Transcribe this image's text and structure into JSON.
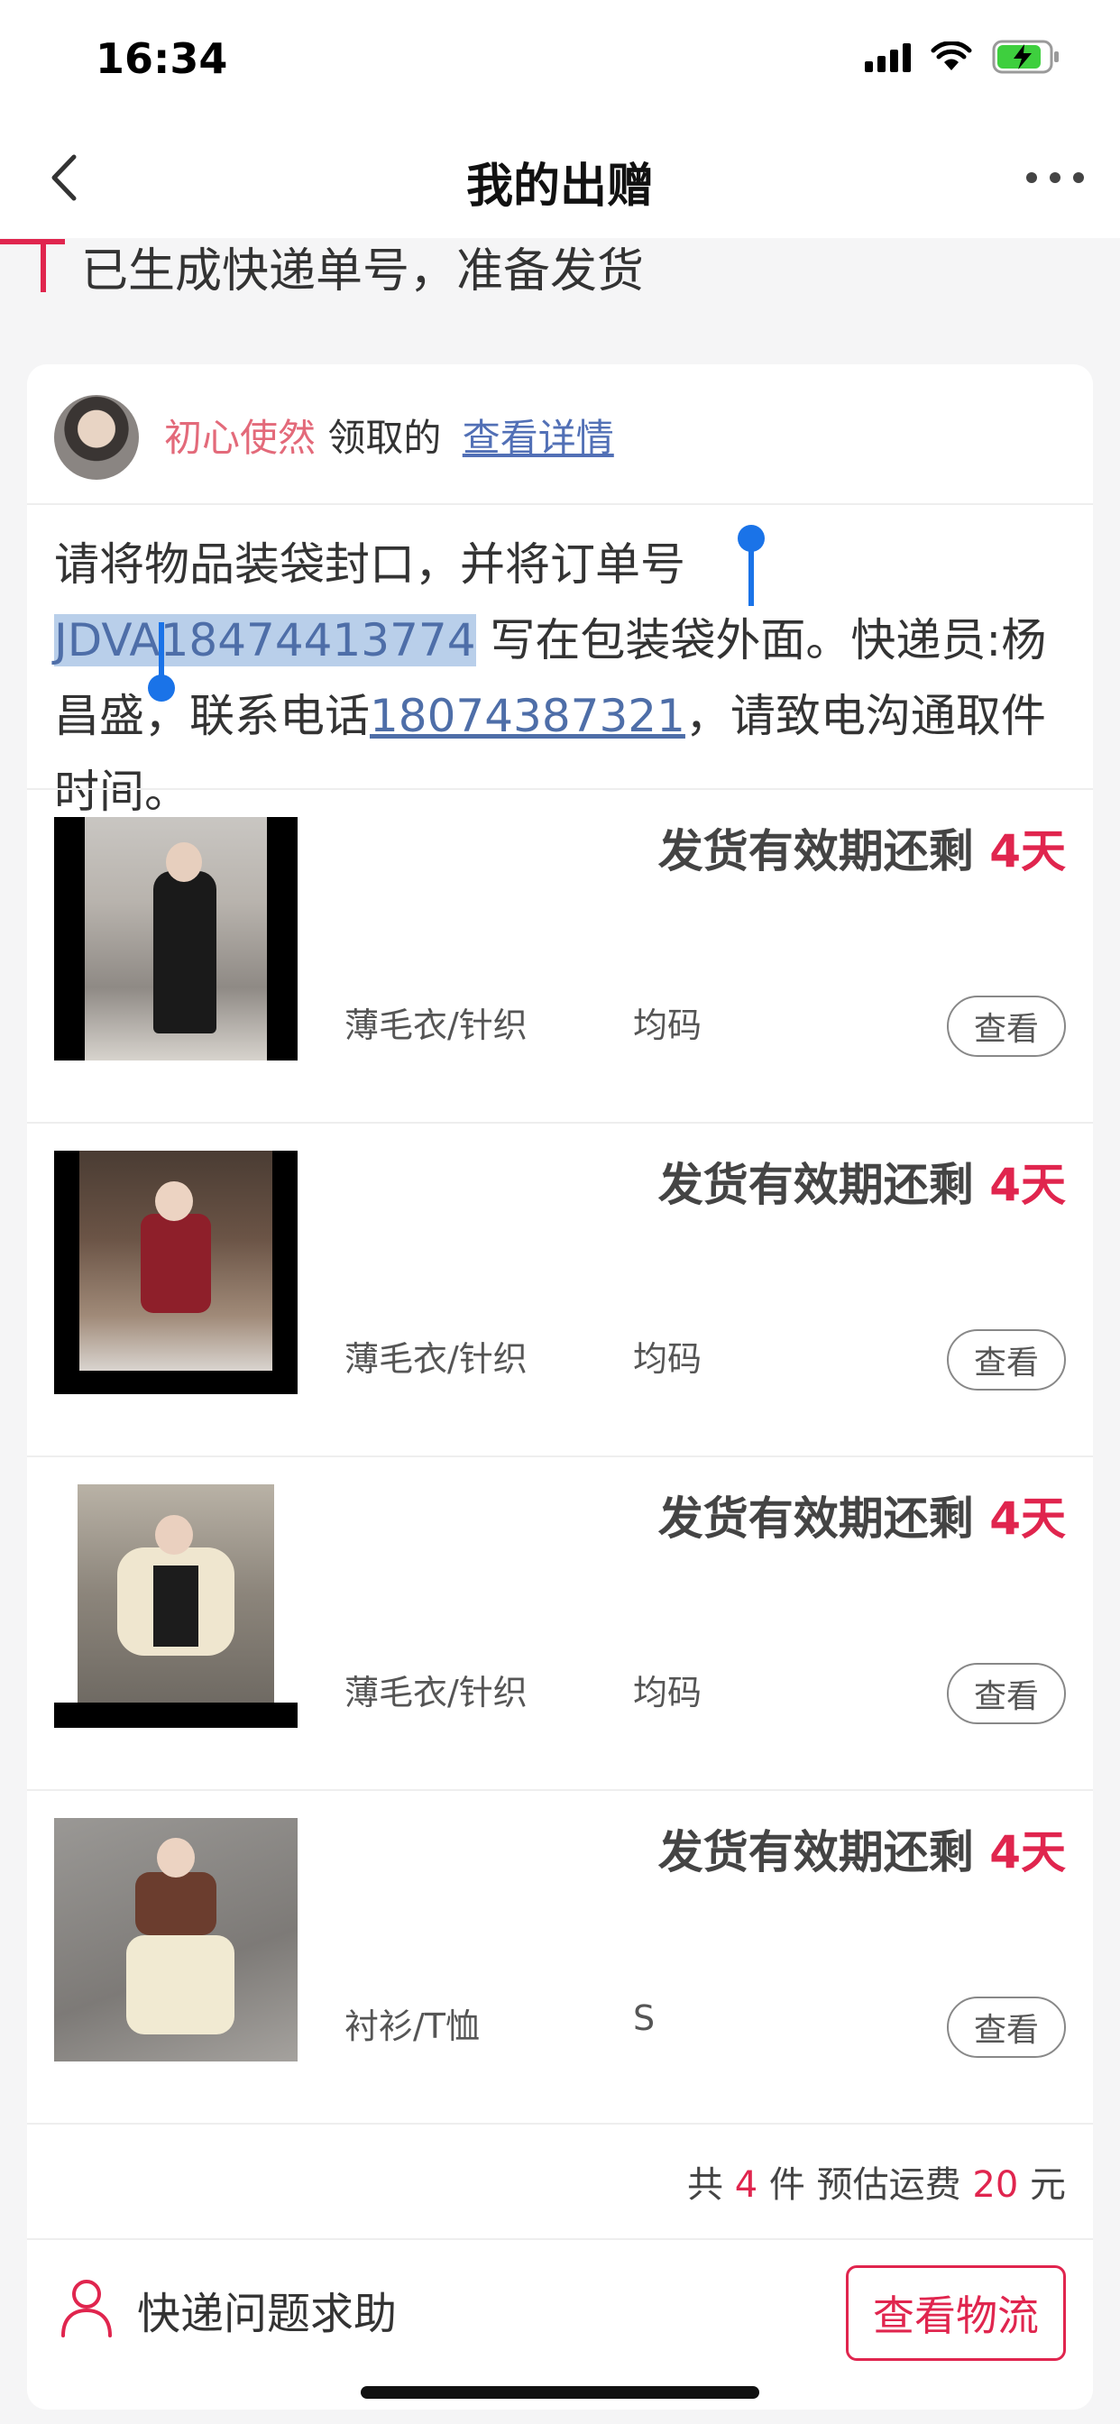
{
  "status_bar": {
    "time": "16:34"
  },
  "nav": {
    "title": "我的出赠"
  },
  "step": {
    "text": "已生成快递单号，准备发货"
  },
  "card": {
    "user": {
      "name": "初心使然",
      "action": "领取的",
      "detail_link": "查看详情"
    },
    "instruction": {
      "part1": "请将物品装袋封口，并将订单号 ",
      "order_no": "JDVA18474413774",
      "part2": " 写在包装袋外面。快递员:杨昌盛，联系电话",
      "phone": "18074387321",
      "part3": "，请致电沟通取件时间。"
    },
    "items": [
      {
        "deadline_label": "发货有效期还剩 ",
        "days": "4天",
        "category": "薄毛衣/针织",
        "size": "均码",
        "view_label": "查看"
      },
      {
        "deadline_label": "发货有效期还剩 ",
        "days": "4天",
        "category": "薄毛衣/针织",
        "size": "均码",
        "view_label": "查看"
      },
      {
        "deadline_label": "发货有效期还剩 ",
        "days": "4天",
        "category": "薄毛衣/针织",
        "size": "均码",
        "view_label": "查看"
      },
      {
        "deadline_label": "发货有效期还剩 ",
        "days": "4天",
        "category": "衬衫/T恤",
        "size": "S",
        "view_label": "查看"
      }
    ],
    "summary": {
      "prefix": "共 ",
      "count": "4",
      "mid": " 件 预估运费 ",
      "fee": "20",
      "suffix": " 元"
    },
    "footer": {
      "help_label": "快递问题求助",
      "track_button": "查看物流"
    }
  },
  "colors": {
    "accent": "#e0254e",
    "link": "#5270b6",
    "username": "#e36a7a",
    "selection": "#b9cfea",
    "handle": "#1a73e8"
  },
  "icons": [
    "back-chevron-icon",
    "more-dots-icon",
    "user-outline-icon",
    "signal-icon",
    "wifi-icon",
    "battery-charging-icon"
  ]
}
